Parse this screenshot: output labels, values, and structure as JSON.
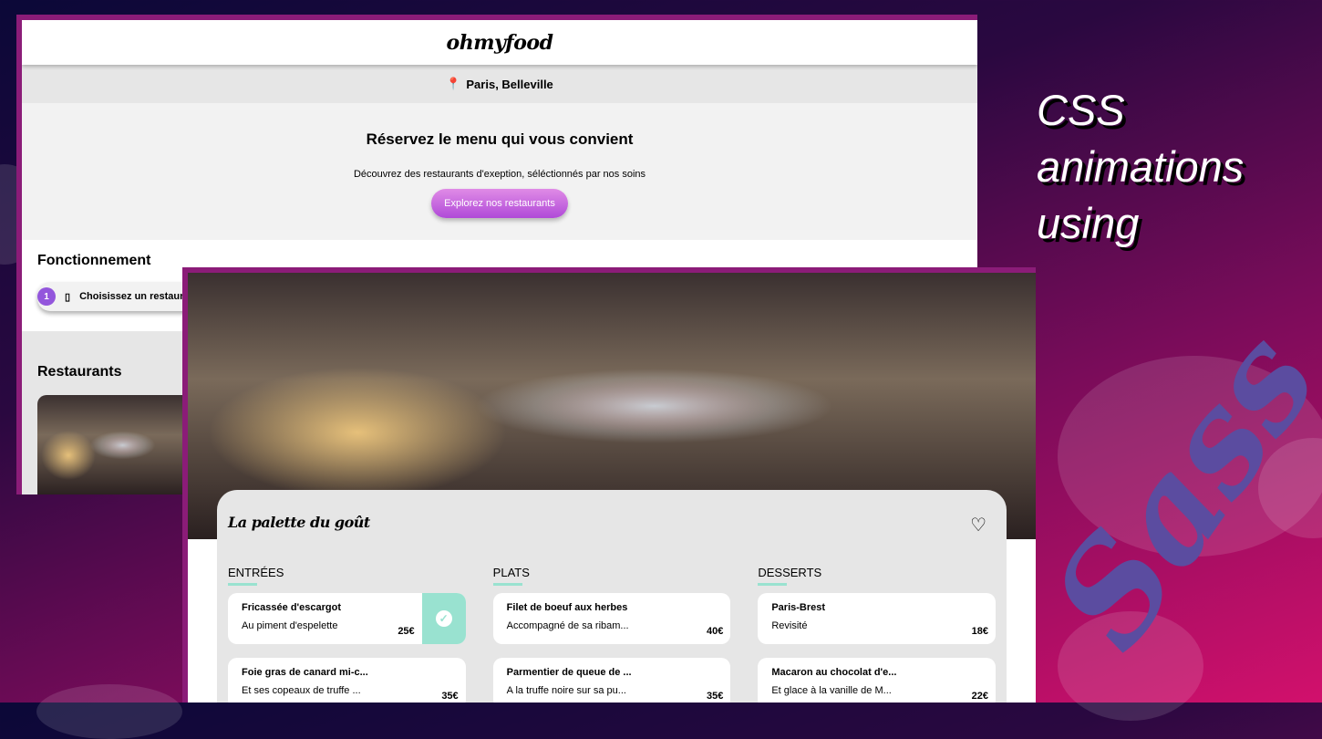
{
  "back_window": {
    "logo": "ohmyfood",
    "location": "Paris, Belleville",
    "hero_title": "Réservez le menu qui vous convient",
    "hero_text": "Découvrez des restaurants d'exeption, séléctionnés par nos soins",
    "hero_button": "Explorez nos restaurants",
    "how_title": "Fonctionnement",
    "step_number": "1",
    "step_label": "Choisissez un restaurant",
    "restaurants_title": "Restaurants"
  },
  "front_window": {
    "restaurant_name": "La palette du goût",
    "columns": [
      {
        "title": "ENTRÉES",
        "dishes": [
          {
            "name": "Fricassée d'escargot",
            "desc": "Au piment d'espelette",
            "price": "25€",
            "selected": true
          },
          {
            "name": "Foie gras de canard mi-c...",
            "desc": "Et ses copeaux de truffe ...",
            "price": "35€"
          }
        ]
      },
      {
        "title": "PLATS",
        "dishes": [
          {
            "name": "Filet de boeuf aux herbes",
            "desc": "Accompagné de sa ribam...",
            "price": "40€"
          },
          {
            "name": "Parmentier de queue de ...",
            "desc": "A la truffe noire sur sa pu...",
            "price": "35€"
          }
        ]
      },
      {
        "title": "DESSERTS",
        "dishes": [
          {
            "name": "Paris-Brest",
            "desc": "Revisité",
            "price": "18€"
          },
          {
            "name": "Macaron au chocolat d'e...",
            "desc": "Et glace à la vanille de M...",
            "price": "22€"
          }
        ]
      }
    ]
  },
  "tagline": [
    "CSS",
    "animations",
    "using"
  ],
  "sass_logo": "Sass",
  "colors": {
    "accent": "#99e2d0",
    "purple": "#9356dc",
    "frame": "#8b1c78"
  }
}
